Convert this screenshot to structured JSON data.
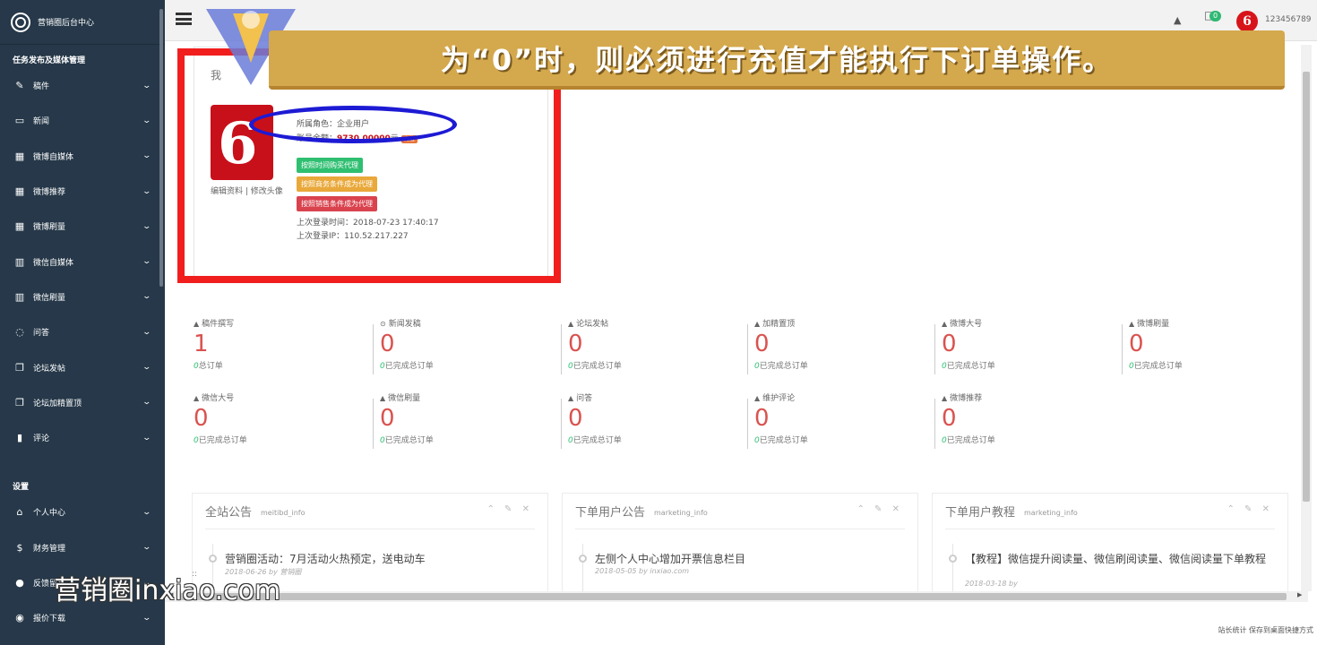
{
  "sidebar": {
    "brand": "营销圈后台中心",
    "section1": "任务发布及媒体管理",
    "items": [
      {
        "label": "稿件",
        "icon": "✎",
        "icon_name": "edit-icon"
      },
      {
        "label": "新闻",
        "icon": "▭",
        "icon_name": "monitor-icon"
      },
      {
        "label": "微博自媒体",
        "icon": "▦",
        "icon_name": "table-icon"
      },
      {
        "label": "微博推荐",
        "icon": "▦",
        "icon_name": "table-icon"
      },
      {
        "label": "微博刷量",
        "icon": "▦",
        "icon_name": "table-icon"
      },
      {
        "label": "微信自媒体",
        "icon": "▥",
        "icon_name": "bar-chart-icon"
      },
      {
        "label": "微信刷量",
        "icon": "▥",
        "icon_name": "bar-chart-icon"
      },
      {
        "label": "问答",
        "icon": "◌",
        "icon_name": "comments-icon"
      },
      {
        "label": "论坛发帖",
        "icon": "❐",
        "icon_name": "copy-icon"
      },
      {
        "label": "论坛加精置顶",
        "icon": "❐",
        "icon_name": "copy-icon"
      },
      {
        "label": "评论",
        "icon": "▮",
        "icon_name": "bookmark-icon"
      }
    ],
    "section2": "设置",
    "items2": [
      {
        "label": "个人中心",
        "icon": "⌂",
        "icon_name": "home-icon"
      },
      {
        "label": "财务管理",
        "icon": "$",
        "icon_name": "dollar-icon"
      },
      {
        "label": "反馈留言",
        "icon": "●",
        "icon_name": "comment-icon"
      },
      {
        "label": "报价下载",
        "icon": "◉",
        "icon_name": "download-circle-icon"
      }
    ]
  },
  "header": {
    "username": "123456789",
    "message_badge": "0"
  },
  "banner": {
    "text": "为“0”时，则必须进行充值才能执行下订单操作。"
  },
  "profile": {
    "title": "我",
    "role_label": "所属角色：",
    "role_value": "企业用户",
    "balance_label": "账号余额：",
    "balance_value": "9730.00000",
    "balance_unit": "元",
    "recharge": "充值",
    "edit_links": "编辑资料 | 修改头像",
    "btn_buy": "按照时间购买代理",
    "btn_business": "按照商务条件成为代理",
    "btn_sales": "按照销售条件成为代理",
    "last_login_time": "上次登录时间：2018-07-23 17:40:17",
    "last_login_ip": "上次登录IP：110.52.217.227"
  },
  "stats": [
    {
      "label": "稿件撰写",
      "icon": "▲",
      "value": "1",
      "sub_zero": "0",
      "sub": "总订单"
    },
    {
      "label": "新闻发稿",
      "icon": "⊙",
      "value": "0",
      "sub_zero": "0",
      "sub": "已完成总订单"
    },
    {
      "label": "论坛发帖",
      "icon": "▲",
      "value": "0",
      "sub_zero": "0",
      "sub": "已完成总订单"
    },
    {
      "label": "加精置顶",
      "icon": "▲",
      "value": "0",
      "sub_zero": "0",
      "sub": "已完成总订单"
    },
    {
      "label": "微博大号",
      "icon": "▲",
      "value": "0",
      "sub_zero": "0",
      "sub": "已完成总订单"
    },
    {
      "label": "微博刷量",
      "icon": "▲",
      "value": "0",
      "sub_zero": "0",
      "sub": "已完成总订单"
    },
    {
      "label": "微信大号",
      "icon": "▲",
      "value": "0",
      "sub_zero": "0",
      "sub": "已完成总订单"
    },
    {
      "label": "微信刷量",
      "icon": "▲",
      "value": "0",
      "sub_zero": "0",
      "sub": "已完成总订单"
    },
    {
      "label": "问答",
      "icon": "▲",
      "value": "0",
      "sub_zero": "0",
      "sub": "已完成总订单"
    },
    {
      "label": "维护评论",
      "icon": "▲",
      "value": "0",
      "sub_zero": "0",
      "sub": "已完成总订单"
    },
    {
      "label": "微博推荐",
      "icon": "▲",
      "value": "0",
      "sub_zero": "0",
      "sub": "已完成总订单"
    }
  ],
  "panels": [
    {
      "title": "全站公告",
      "sub": "meitibd_info",
      "post": "营销圈活动：7月活动火热预定，送电动车",
      "meta": "2018-06-26 by 营销圈"
    },
    {
      "title": "下单用户公告",
      "sub": "marketing_info",
      "post": "左侧个人中心增加开票信息栏目",
      "meta": "2018-05-05 by inxiao.com"
    },
    {
      "title": "下单用户教程",
      "sub": "marketing_info",
      "post": "【教程】微信提升阅读量、微信刷阅读量、微信阅读量下单教程",
      "meta": "2018-03-18 by"
    }
  ],
  "watermark": "营销圈inxiao.com",
  "footer": "站长统计 保存到桌面快捷方式"
}
